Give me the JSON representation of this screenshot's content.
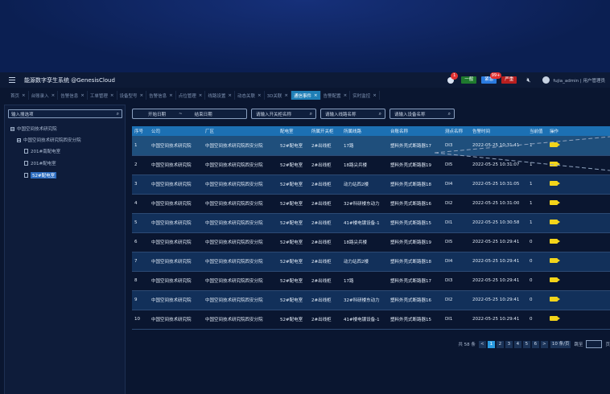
{
  "header": {
    "title": "能源数字孪生系统 @GenesisCloud",
    "bell_count": "1",
    "levels": [
      {
        "label": "一般"
      },
      {
        "label": "紧急",
        "badge": "99+"
      },
      {
        "label": "严重"
      }
    ],
    "user": "fujia_admin | 用户管理员"
  },
  "tabs": [
    {
      "label": "首页"
    },
    {
      "label": "台账录入"
    },
    {
      "label": "告警信息"
    },
    {
      "label": "工单管理"
    },
    {
      "label": "设备型号"
    },
    {
      "label": "告警信息"
    },
    {
      "label": "点位管理"
    },
    {
      "label": "线路设置"
    },
    {
      "label": "动态关联"
    },
    {
      "label": "3D关联"
    },
    {
      "label": "通信事件",
      "active": true
    },
    {
      "label": "告警配置"
    },
    {
      "label": "实时监控"
    }
  ],
  "sidebar": {
    "search_label": "输入搜选项",
    "tree": [
      {
        "label": "中国空间技术研究院",
        "type": "box"
      },
      {
        "label": "中国空间技术研究院西安分院",
        "type": "box"
      },
      {
        "label": "201#南配电室",
        "type": "doc"
      },
      {
        "label": "201#配电室",
        "type": "doc"
      },
      {
        "label": "52#配电室",
        "type": "doc",
        "selected": true
      }
    ]
  },
  "filters": {
    "start_date": "开始日期",
    "sep": "~",
    "end_date": "结束日期",
    "cabinet": "请输入开关柜名称",
    "line": "请输入线路名称",
    "device": "请输入设备名称"
  },
  "table": {
    "columns": [
      "序号",
      "公司",
      "厂区",
      "配电室",
      "所属开关柜",
      "所属线路",
      "台账名称",
      "测点名称",
      "告警时间",
      "当前值",
      "操作"
    ],
    "rows": [
      [
        "1",
        "中国空间技术研究院",
        "中国空间技术研究院西安分院",
        "52#配电室",
        "2#出线柜",
        "17路",
        "塑料外壳式断路器17",
        "DI3",
        "2022-05-25 10:31:41",
        "1",
        ""
      ],
      [
        "2",
        "中国空间技术研究院",
        "中国空间技术研究院西安分院",
        "52#配电室",
        "2#出线柜",
        "18路尖兵楼",
        "塑料外壳式断路器19",
        "DI5",
        "2022-05-25 10:31:07",
        "1",
        ""
      ],
      [
        "3",
        "中国空间技术研究院",
        "中国空间技术研究院西安分院",
        "52#配电室",
        "2#出线柜",
        "动力站西2楼",
        "塑料外壳式断路器18",
        "DI4",
        "2022-05-25 10:31:05",
        "1",
        ""
      ],
      [
        "4",
        "中国空间技术研究院",
        "中国空间技术研究院西安分院",
        "52#配电室",
        "2#出线柜",
        "32#科研楼东动力",
        "塑料外壳式断路器16",
        "DI2",
        "2022-05-25 10:31:00",
        "1",
        ""
      ],
      [
        "5",
        "中国空间技术研究院",
        "中国空间技术研究院西安分院",
        "52#配电室",
        "2#出线柜",
        "41#楼电镀设备-1",
        "塑料外壳式断路器15",
        "DI1",
        "2022-05-25 10:30:58",
        "1",
        ""
      ],
      [
        "6",
        "中国空间技术研究院",
        "中国空间技术研究院西安分院",
        "52#配电室",
        "2#出线柜",
        "18路尖兵楼",
        "塑料外壳式断路器19",
        "DI5",
        "2022-05-25 10:29:41",
        "0",
        ""
      ],
      [
        "7",
        "中国空间技术研究院",
        "中国空间技术研究院西安分院",
        "52#配电室",
        "2#出线柜",
        "动力站西2楼",
        "塑料外壳式断路器18",
        "DI4",
        "2022-05-25 10:29:41",
        "0",
        ""
      ],
      [
        "8",
        "中国空间技术研究院",
        "中国空间技术研究院西安分院",
        "52#配电室",
        "2#出线柜",
        "17路",
        "塑料外壳式断路器17",
        "DI3",
        "2022-05-25 10:29:41",
        "0",
        ""
      ],
      [
        "9",
        "中国空间技术研究院",
        "中国空间技术研究院西安分院",
        "52#配电室",
        "2#出线柜",
        "32#科研楼东动力",
        "塑料外壳式断路器16",
        "DI2",
        "2022-05-25 10:29:41",
        "0",
        ""
      ],
      [
        "10",
        "中国空间技术研究院",
        "中国空间技术研究院西安分院",
        "52#配电室",
        "2#出线柜",
        "41#楼电镀设备-1",
        "塑料外壳式断路器15",
        "DI1",
        "2022-05-25 10:29:41",
        "0",
        ""
      ]
    ]
  },
  "pager": {
    "total": "共 58 条",
    "pages": [
      "1",
      "2",
      "3",
      "4",
      "5",
      "6"
    ],
    "current": "1",
    "per_page": "10 条/页",
    "goto": "跳至",
    "page_unit": "页"
  }
}
